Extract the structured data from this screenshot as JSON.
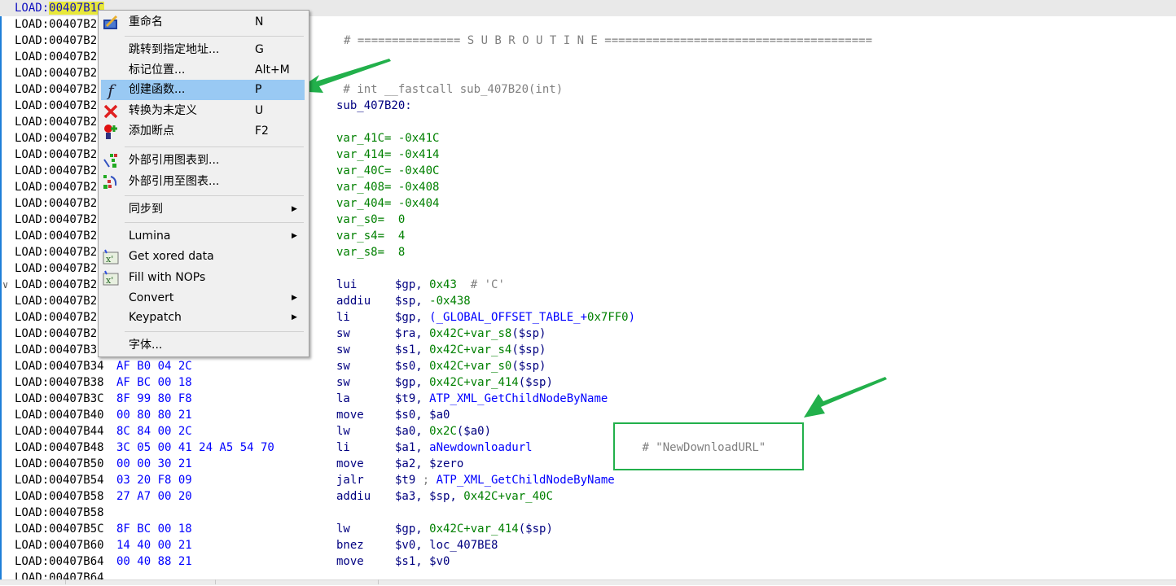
{
  "colors": {
    "accent": "#99c9f3",
    "annotation": "#22b04b",
    "address_highlight": "#e8e83a"
  },
  "listing": [
    {
      "addr_prefix": "LOAD:",
      "addr_hl": "00407B1C",
      "current": true
    },
    {
      "addr": "LOAD:00407B2"
    },
    {
      "addr": "LOAD:00407B2",
      "text": [
        {
          "t": "# =============== S U B R O U T I N E =======================================",
          "c": "cmt"
        }
      ],
      "indent": true
    },
    {
      "addr": "LOAD:00407B2"
    },
    {
      "addr": "LOAD:00407B2"
    },
    {
      "addr": "LOAD:00407B2",
      "text": [
        {
          "t": " # int __fastcall sub_407B20(int)",
          "c": "cmt"
        }
      ]
    },
    {
      "addr": "LOAD:00407B2",
      "text": [
        {
          "t": "sub_407B20:",
          "c": "lbl"
        }
      ]
    },
    {
      "addr": "LOAD:00407B2"
    },
    {
      "addr": "LOAD:00407B2",
      "text": [
        {
          "t": "var_41C= -0x41C",
          "c": "var"
        }
      ]
    },
    {
      "addr": "LOAD:00407B2",
      "text": [
        {
          "t": "var_414= -0x414",
          "c": "var"
        }
      ]
    },
    {
      "addr": "LOAD:00407B2",
      "text": [
        {
          "t": "var_40C= -0x40C",
          "c": "var"
        }
      ]
    },
    {
      "addr": "LOAD:00407B2",
      "text": [
        {
          "t": "var_408= -0x408",
          "c": "var"
        }
      ]
    },
    {
      "addr": "LOAD:00407B2",
      "text": [
        {
          "t": "var_404= -0x404",
          "c": "var"
        }
      ]
    },
    {
      "addr": "LOAD:00407B2",
      "text": [
        {
          "t": "var_s0=  0",
          "c": "var"
        }
      ]
    },
    {
      "addr": "LOAD:00407B2",
      "text": [
        {
          "t": "var_s4=  4",
          "c": "var"
        }
      ]
    },
    {
      "addr": "LOAD:00407B2",
      "text": [
        {
          "t": "var_s8=  8",
          "c": "var"
        }
      ]
    },
    {
      "addr": "LOAD:00407B2"
    },
    {
      "addr": "LOAD:00407B2",
      "chevron": true,
      "mn": "lui",
      "ops": [
        {
          "t": "$gp, ",
          "c": "reg"
        },
        {
          "t": "0x43",
          "c": "num"
        },
        {
          "t": "  # 'C'",
          "c": "cmt"
        }
      ]
    },
    {
      "addr": "LOAD:00407B2",
      "mn": "addiu",
      "ops": [
        {
          "t": "$sp, ",
          "c": "reg"
        },
        {
          "t": "-0x438",
          "c": "num"
        }
      ]
    },
    {
      "addr": "LOAD:00407B2",
      "mn": "li",
      "ops": [
        {
          "t": "$gp, ",
          "c": "reg"
        },
        {
          "t": "(_GLOBAL_OFFSET_TABLE_+",
          "c": "name"
        },
        {
          "t": "0x7FF0",
          "c": "num"
        },
        {
          "t": ")",
          "c": "name"
        }
      ]
    },
    {
      "addr": "LOAD:00407B2",
      "mn": "sw",
      "ops": [
        {
          "t": "$ra, ",
          "c": "reg"
        },
        {
          "t": "0x42C+var_s8",
          "c": "num"
        },
        {
          "t": "($sp)",
          "c": "reg"
        }
      ]
    },
    {
      "addr": "LOAD:00407B3",
      "mn": "sw",
      "ops": [
        {
          "t": "$s1, ",
          "c": "reg"
        },
        {
          "t": "0x42C+var_s4",
          "c": "num"
        },
        {
          "t": "($sp)",
          "c": "reg"
        }
      ]
    },
    {
      "addr": "LOAD:00407B34",
      "bytes": "AF B0 04 2C",
      "mn": "sw",
      "ops": [
        {
          "t": "$s0, ",
          "c": "reg"
        },
        {
          "t": "0x42C+var_s0",
          "c": "num"
        },
        {
          "t": "($sp)",
          "c": "reg"
        }
      ]
    },
    {
      "addr": "LOAD:00407B38",
      "bytes": "AF BC 00 18",
      "mn": "sw",
      "ops": [
        {
          "t": "$gp, ",
          "c": "reg"
        },
        {
          "t": "0x42C+var_414",
          "c": "num"
        },
        {
          "t": "($sp)",
          "c": "reg"
        }
      ]
    },
    {
      "addr": "LOAD:00407B3C",
      "bytes": "8F 99 80 F8",
      "mn": "la",
      "ops": [
        {
          "t": "$t9, ",
          "c": "reg"
        },
        {
          "t": "ATP_XML_GetChildNodeByName",
          "c": "name"
        }
      ]
    },
    {
      "addr": "LOAD:00407B40",
      "bytes": "00 80 80 21",
      "mn": "move",
      "ops": [
        {
          "t": "$s0, $a0",
          "c": "reg"
        }
      ]
    },
    {
      "addr": "LOAD:00407B44",
      "bytes": "8C 84 00 2C",
      "mn": "lw",
      "ops": [
        {
          "t": "$a0, ",
          "c": "reg"
        },
        {
          "t": "0x2C",
          "c": "num"
        },
        {
          "t": "($a0)",
          "c": "reg"
        }
      ]
    },
    {
      "addr": "LOAD:00407B48",
      "bytes": "3C 05 00 41 24 A5 54 70",
      "mn": "li",
      "ops": [
        {
          "t": "$a1, ",
          "c": "reg"
        },
        {
          "t": "aNewdownloadurl",
          "c": "name"
        },
        {
          "t": "                # \"NewDownloadURL\"",
          "c": "cmt"
        }
      ]
    },
    {
      "addr": "LOAD:00407B50",
      "bytes": "00 00 30 21",
      "mn": "move",
      "ops": [
        {
          "t": "$a2, $zero",
          "c": "reg"
        }
      ]
    },
    {
      "addr": "LOAD:00407B54",
      "bytes": "03 20 F8 09",
      "mn": "jalr",
      "ops": [
        {
          "t": "$t9 ",
          "c": "reg"
        },
        {
          "t": "; ",
          "c": "cmt"
        },
        {
          "t": "ATP_XML_GetChildNodeByName",
          "c": "name"
        }
      ]
    },
    {
      "addr": "LOAD:00407B58",
      "bytes": "27 A7 00 20",
      "mn": "addiu",
      "ops": [
        {
          "t": "$a3, $sp, ",
          "c": "reg"
        },
        {
          "t": "0x42C+var_40C",
          "c": "num"
        }
      ]
    },
    {
      "addr": "LOAD:00407B58"
    },
    {
      "addr": "LOAD:00407B5C",
      "bytes": "8F BC 00 18",
      "mn": "lw",
      "ops": [
        {
          "t": "$gp, ",
          "c": "reg"
        },
        {
          "t": "0x42C+var_414",
          "c": "num"
        },
        {
          "t": "($sp)",
          "c": "reg"
        }
      ]
    },
    {
      "addr": "LOAD:00407B60",
      "bytes": "14 40 00 21",
      "mn": "bnez",
      "ops": [
        {
          "t": "$v0, loc_407BE8",
          "c": "reg"
        }
      ]
    },
    {
      "addr": "LOAD:00407B64",
      "bytes": "00 40 88 21",
      "mn": "move",
      "ops": [
        {
          "t": "$s1, $v0",
          "c": "reg"
        }
      ]
    },
    {
      "addr": "LOAD:00407B64"
    }
  ],
  "context_menu": {
    "items": [
      {
        "label": "重命名",
        "shortcut": "N",
        "icon": "rename-icon"
      },
      {
        "sep": true
      },
      {
        "label": "跳转到指定地址...",
        "shortcut": "G"
      },
      {
        "label": "标记位置...",
        "shortcut": "Alt+M"
      },
      {
        "label": "创建函数...",
        "shortcut": "P",
        "icon": "function-icon",
        "selected": true
      },
      {
        "label": "转换为未定义",
        "shortcut": "U",
        "icon": "undefine-x-icon"
      },
      {
        "label": "添加断点",
        "shortcut": "F2",
        "icon": "breakpoint-icon"
      },
      {
        "sep": true
      },
      {
        "label": "外部引用图表到...",
        "icon": "xref-graph-to-icon"
      },
      {
        "label": "外部引用至图表...",
        "icon": "xref-graph-from-icon"
      },
      {
        "sep": true
      },
      {
        "label": "同步到",
        "submenu": true
      },
      {
        "sep": true
      },
      {
        "label": "Lumina",
        "submenu": true
      },
      {
        "label": "Get xored data",
        "icon": "script-plugin-icon"
      },
      {
        "label": "Fill with NOPs",
        "icon": "script-plugin-icon"
      },
      {
        "label": "Convert",
        "submenu": true
      },
      {
        "label": "Keypatch",
        "submenu": true
      },
      {
        "sep": true
      },
      {
        "label": "字体..."
      }
    ]
  }
}
